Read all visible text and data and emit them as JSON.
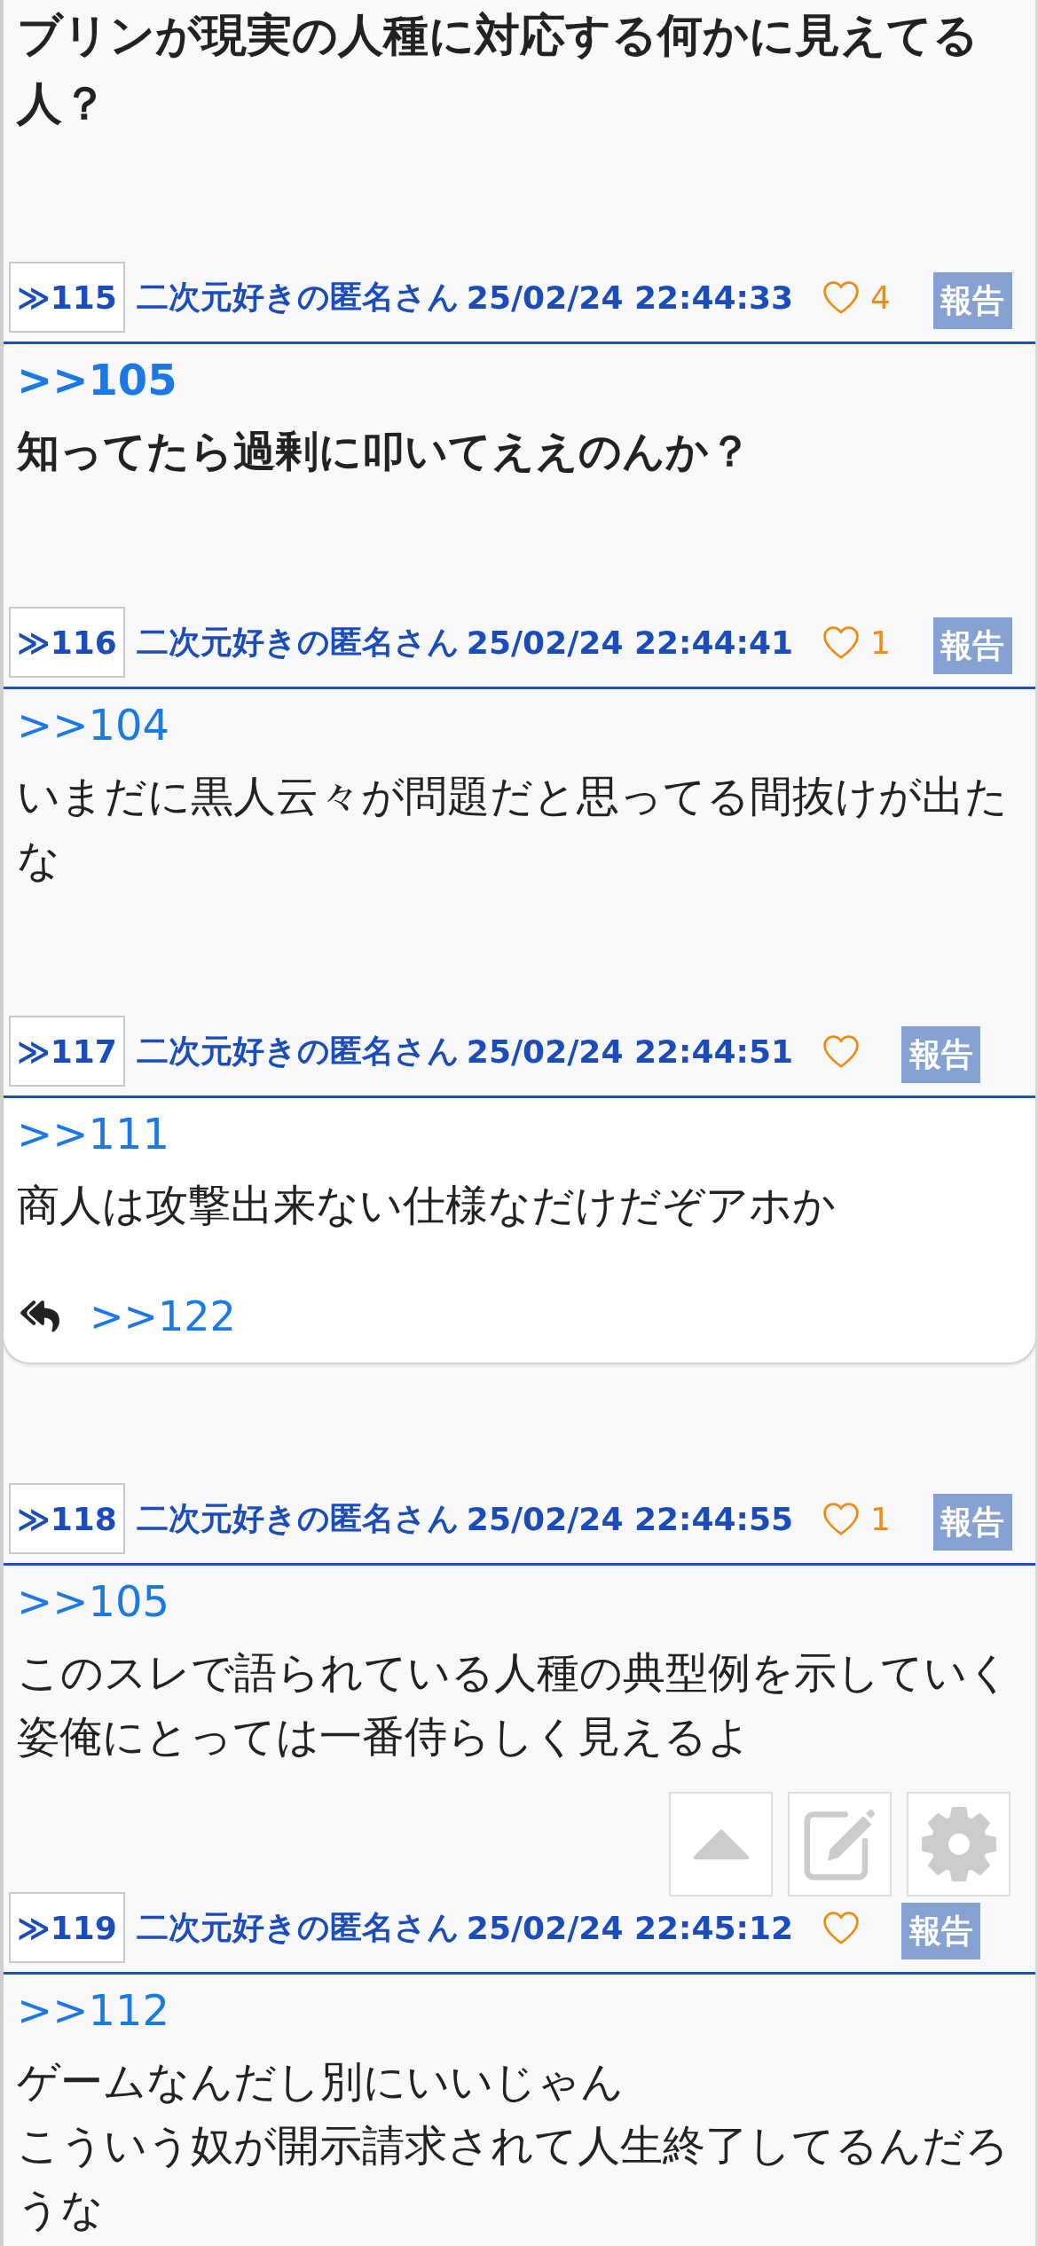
{
  "posts": [
    {
      "kind": "large",
      "lines": [
        "ブリンが現実の人種に対応する何かに見えてる人？"
      ]
    },
    {
      "number": "≫115",
      "author": "二次元好きの匿名さん",
      "date": "25/02/24 22:44:33",
      "likes": "4",
      "report": "報告",
      "kind": "bold",
      "anchor": ">>105",
      "lines": [
        "知ってたら過剰に叩いてええのんか？"
      ]
    },
    {
      "number": "≫116",
      "author": "二次元好きの匿名さん",
      "date": "25/02/24 22:44:41",
      "likes": "1",
      "report": "報告",
      "kind": "plain",
      "anchor": ">>104",
      "lines": [
        "いまだに黒人云々が問題だと思ってる間抜けが出たな"
      ]
    },
    {
      "number": "≫117",
      "author": "二次元好きの匿名さん",
      "date": "25/02/24 22:44:51",
      "report": "報告",
      "kind": "plain",
      "anchor": ">>111",
      "lines": [
        "商人は攻撃出来ない仕様なだけだぞアホか"
      ],
      "replies": [
        ">>122"
      ]
    },
    {
      "number": "≫118",
      "author": "二次元好きの匿名さん",
      "date": "25/02/24 22:44:55",
      "likes": "1",
      "report": "報告",
      "kind": "plain",
      "anchor": ">>105",
      "lines": [
        "このスレで語られている人種の典型例を示していく姿俺にとっては一番侍らしく見えるよ"
      ]
    },
    {
      "number": "≫119",
      "author": "二次元好きの匿名さん",
      "date": "25/02/24 22:45:12",
      "report": "報告",
      "kind": "plain",
      "anchor": ">>112",
      "lines": [
        "ゲームなんだし別にいいじゃん",
        "こういう奴が開示請求されて人生終了してるんだろうな"
      ]
    }
  ]
}
